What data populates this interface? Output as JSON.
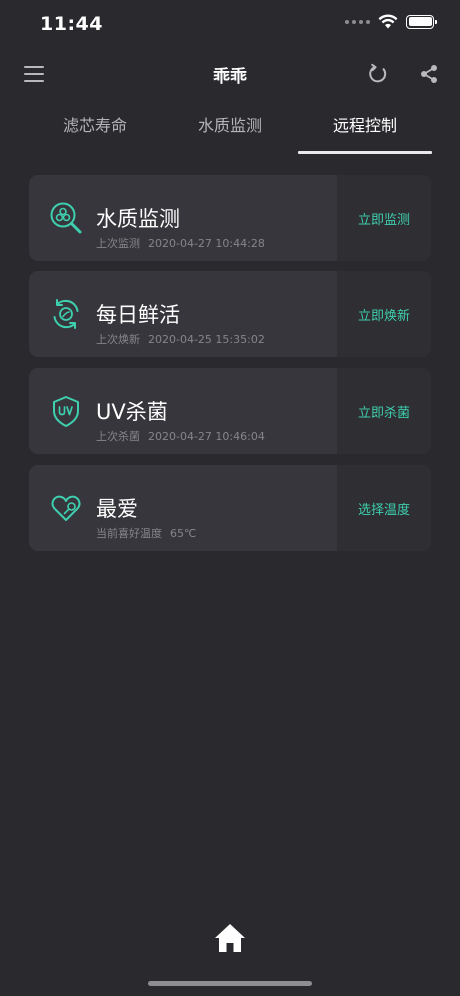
{
  "status_bar": {
    "time": "11:44"
  },
  "nav": {
    "title": "乖乖",
    "menu_icon": "menu-icon",
    "refresh_icon": "refresh-icon",
    "share_icon": "share-icon"
  },
  "tabs": [
    {
      "label": "滤芯寿命",
      "active": false
    },
    {
      "label": "水质监测",
      "active": false
    },
    {
      "label": "远程控制",
      "active": true
    }
  ],
  "cards": [
    {
      "icon": "water-quality-icon",
      "title": "水质监测",
      "sub_label": "上次监测",
      "sub_value": "2020-04-27 10:44:28",
      "action": "立即监测"
    },
    {
      "icon": "daily-refresh-icon",
      "title": "每日鲜活",
      "sub_label": "上次焕新",
      "sub_value": "2020-04-25 15:35:02",
      "action": "立即焕新"
    },
    {
      "icon": "uv-shield-icon",
      "title": "UV杀菌",
      "sub_label": "上次杀菌",
      "sub_value": "2020-04-27 10:46:04",
      "action": "立即杀菌"
    },
    {
      "icon": "favorite-heart-icon",
      "title": "最爱",
      "sub_label": "当前喜好温度",
      "sub_value": "65℃",
      "action": "选择温度"
    }
  ],
  "colors": {
    "accent": "#3ecfae",
    "background": "#2a2a2e",
    "card": "#37363c",
    "card_action": "#2e2e33"
  },
  "bottom": {
    "home_icon": "home-icon"
  }
}
